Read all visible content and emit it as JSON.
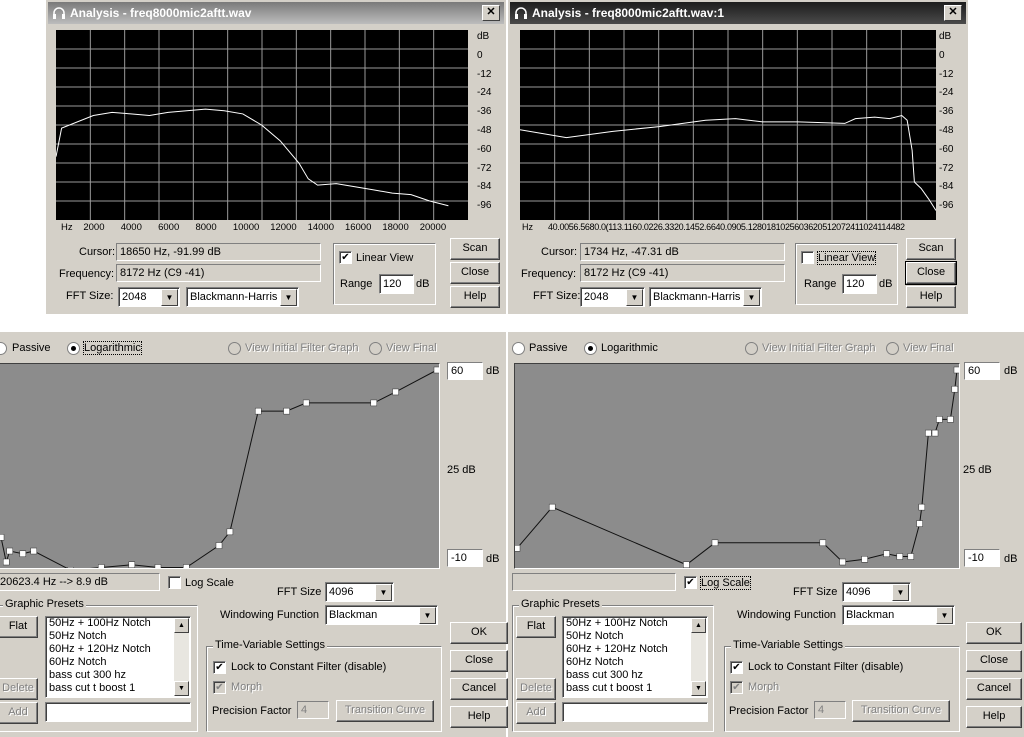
{
  "analysis_left": {
    "title": "Analysis - freq8000mic2aftt.wav",
    "close_glyph": "✕",
    "y_labels": [
      "dB",
      "0",
      "-12",
      "-24",
      "-36",
      "-48",
      "-60",
      "-72",
      "-84",
      "-96"
    ],
    "x_labels": [
      "Hz",
      "2000",
      "4000",
      "6000",
      "8000",
      "10000",
      "12000",
      "14000",
      "16000",
      "18000",
      "20000"
    ],
    "curve": [
      [
        0,
        -68
      ],
      [
        300,
        -50
      ],
      [
        2000,
        -42
      ],
      [
        3000,
        -40
      ],
      [
        4000,
        -41
      ],
      [
        5000,
        -42
      ],
      [
        6000,
        -40
      ],
      [
        7000,
        -39
      ],
      [
        8000,
        -38
      ],
      [
        9000,
        -39
      ],
      [
        10000,
        -41
      ],
      [
        11000,
        -48
      ],
      [
        12000,
        -58
      ],
      [
        13000,
        -72
      ],
      [
        13500,
        -82
      ],
      [
        14000,
        -86
      ],
      [
        15000,
        -85
      ],
      [
        16000,
        -87
      ],
      [
        17000,
        -89
      ],
      [
        18000,
        -91
      ],
      [
        19000,
        -92
      ],
      [
        20000,
        -96
      ],
      [
        21000,
        -99
      ]
    ],
    "cursor_label": "Cursor:",
    "cursor_value": "18650 Hz, -91.99 dB",
    "frequency_label": "Frequency:",
    "frequency_value": "8172 Hz (C9 -41)",
    "fft_label": "FFT Size:",
    "fft_value": "2048",
    "window_value": "Blackmann-Harris",
    "linear_view_label": "Linear View",
    "linear_view_checked": true,
    "range_label": "Range",
    "range_value": "120",
    "range_unit": "dB",
    "scan_label": "Scan",
    "close_label": "Close",
    "help_label": "Help"
  },
  "analysis_right": {
    "title": "Analysis - freq8000mic2aftt.wav:1",
    "close_glyph": "✕",
    "y_labels": [
      "dB",
      "0",
      "-12",
      "-24",
      "-36",
      "-48",
      "-60",
      "-72",
      "-84",
      "-96"
    ],
    "x_labels_text": "40.0056.5680.0(113.1160.0226.3320.1452.6640.0905.1280181025603620512072411024114482",
    "hz_label": "Hz",
    "curve_note": "log axis 40–20000 Hz",
    "curve": [
      [
        40,
        -51
      ],
      [
        80,
        -56
      ],
      [
        160,
        -52
      ],
      [
        320,
        -49
      ],
      [
        640,
        -45
      ],
      [
        1000,
        -44
      ],
      [
        1500,
        -46
      ],
      [
        2560,
        -46
      ],
      [
        5120,
        -47
      ],
      [
        6000,
        -44
      ],
      [
        8000,
        -43
      ],
      [
        10000,
        -44
      ],
      [
        12000,
        -42
      ],
      [
        13000,
        -45
      ],
      [
        14000,
        -64
      ],
      [
        14482,
        -84
      ],
      [
        16000,
        -88
      ],
      [
        18000,
        -95
      ],
      [
        20000,
        -102
      ]
    ],
    "cursor_label": "Cursor:",
    "cursor_value": "1734 Hz, -47.31 dB",
    "frequency_label": "Frequency:",
    "frequency_value": "8172 Hz (C9 -41)",
    "fft_label": "FFT Size:",
    "fft_value": "2048",
    "window_value": "Blackmann-Harris",
    "linear_view_label": "Linear View",
    "linear_view_checked": false,
    "range_label": "Range",
    "range_value": "120",
    "range_unit": "dB",
    "scan_label": "Scan",
    "close_label": "Close",
    "help_label": "Help"
  },
  "filter_left": {
    "passive_label": "Passive",
    "logarithmic_label": "Logarithmic",
    "view_initial_label": "View Initial Filter Graph",
    "view_final_label": "View Final",
    "db_top": "60",
    "db_mid": "25 dB",
    "db_bottom": "-10",
    "db_unit": "dB",
    "points": [
      [
        0.0,
        -1
      ],
      [
        0.012,
        -10
      ],
      [
        0.02,
        -6
      ],
      [
        0.05,
        -7
      ],
      [
        0.075,
        -6
      ],
      [
        0.16,
        -13
      ],
      [
        0.23,
        -12
      ],
      [
        0.3,
        -11
      ],
      [
        0.36,
        -12
      ],
      [
        0.425,
        -12
      ],
      [
        0.5,
        -4
      ],
      [
        0.525,
        1
      ],
      [
        0.59,
        45
      ],
      [
        0.655,
        45
      ],
      [
        0.7,
        48
      ],
      [
        0.855,
        48
      ],
      [
        0.905,
        52
      ],
      [
        1.0,
        60
      ]
    ],
    "status_value": "20623.4 Hz --> 8.9 dB",
    "log_scale_label": "Log Scale",
    "log_scale_checked": false,
    "fft_label": "FFT Size",
    "fft_value": "4096",
    "windowing_label": "Windowing Function",
    "windowing_value": "Blackman",
    "presets_caption": "Graphic Presets",
    "flat_label": "Flat",
    "delete_label": "Delete",
    "add_label": "Add",
    "presets": [
      "50Hz + 100Hz Notch",
      "50Hz Notch",
      "60Hz + 120Hz Notch",
      "60Hz Notch",
      "bass cut 300 hz",
      "bass cut t boost 1"
    ],
    "tv_caption": "Time-Variable Settings",
    "lock_label": "Lock to Constant Filter (disable)",
    "morph_label": "Morph",
    "precision_label": "Precision Factor",
    "precision_value": "4",
    "transition_label": "Transition Curve",
    "ok_label": "OK",
    "close_label": "Close",
    "cancel_label": "Cancel",
    "help_label": "Help"
  },
  "filter_right": {
    "passive_label": "Passive",
    "logarithmic_label": "Logarithmic",
    "view_initial_label": "View Initial Filter Graph",
    "view_final_label": "View Final",
    "db_top": "60",
    "db_mid": "25 dB",
    "db_bottom": "-10",
    "db_unit": "dB",
    "points": [
      [
        0.0,
        -5
      ],
      [
        0.08,
        10
      ],
      [
        0.385,
        -11
      ],
      [
        0.45,
        -3
      ],
      [
        0.695,
        -3
      ],
      [
        0.74,
        -10
      ],
      [
        0.79,
        -9
      ],
      [
        0.84,
        -7
      ],
      [
        0.87,
        -8
      ],
      [
        0.895,
        -8
      ],
      [
        0.915,
        4
      ],
      [
        0.92,
        10
      ],
      [
        0.935,
        37
      ],
      [
        0.95,
        37
      ],
      [
        0.96,
        42
      ],
      [
        0.985,
        42
      ],
      [
        0.995,
        53
      ],
      [
        1.0,
        60
      ]
    ],
    "status_value": "",
    "log_scale_label": "Log Scale",
    "log_scale_checked": true,
    "fft_label": "FFT Size",
    "fft_value": "4096",
    "windowing_label": "Windowing Function",
    "windowing_value": "Blackman",
    "presets_caption": "Graphic Presets",
    "flat_label": "Flat",
    "delete_label": "Delete",
    "add_label": "Add",
    "presets": [
      "50Hz + 100Hz Notch",
      "50Hz Notch",
      "60Hz + 120Hz Notch",
      "60Hz Notch",
      "bass cut 300 hz",
      "bass cut t boost 1"
    ],
    "tv_caption": "Time-Variable Settings",
    "lock_label": "Lock to Constant Filter (disable)",
    "morph_label": "Morph",
    "precision_label": "Precision Factor",
    "precision_value": "4",
    "transition_label": "Transition Curve",
    "ok_label": "OK",
    "close_label": "Close",
    "cancel_label": "Cancel",
    "help_label": "Help"
  },
  "colors": {
    "face": "#d4d0c8",
    "plot_bg": "#000000",
    "grid": "#9a9a9a",
    "curve": "#ffffff",
    "filter_bg": "#8c8c8c"
  }
}
